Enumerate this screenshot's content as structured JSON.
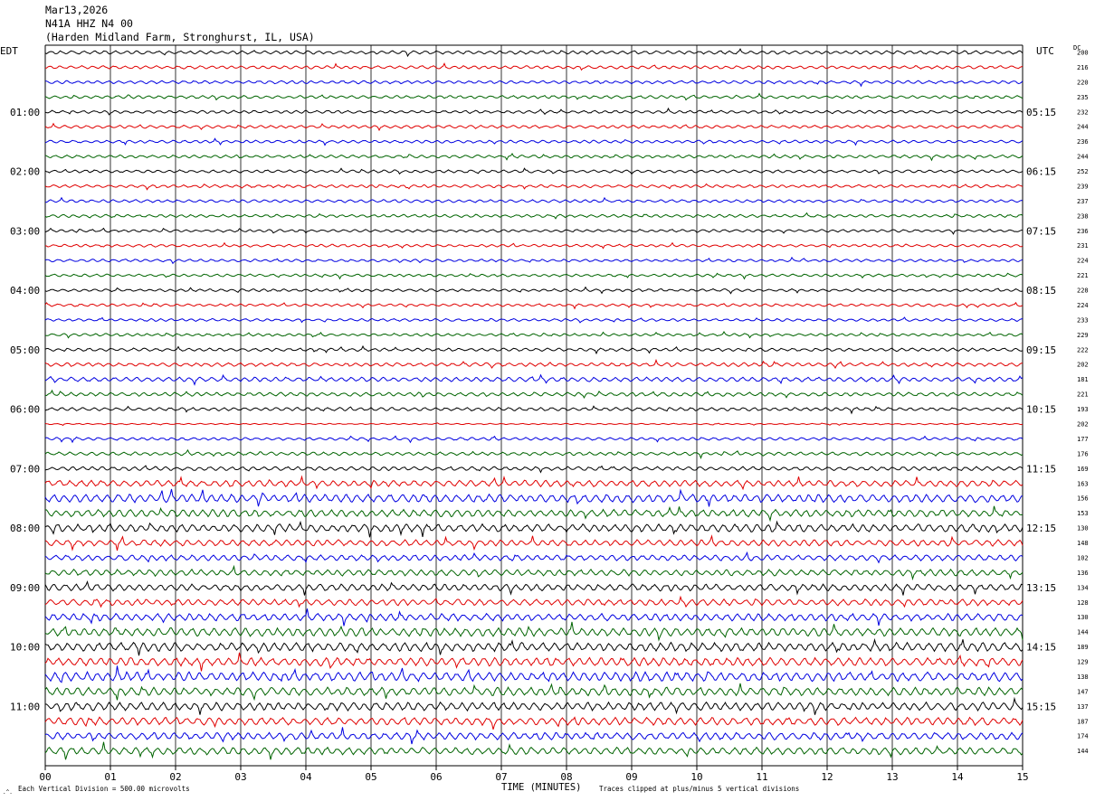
{
  "header": {
    "date": "Mar13,2026",
    "channel": "N41A HHZ N4 00",
    "location": "(Harden Midland Farm, Stronghurst, IL, USA)"
  },
  "labels": {
    "left_tz": "EDT",
    "right_tz": "UTC",
    "dc": "DC",
    "xlabel": "TIME (MINUTES)",
    "footer_left": "Each Vertical Division =  500.00 microvolts",
    "footer_right": "Traces clipped at plus/minus 5 vertical divisions"
  },
  "colors": {
    "black": "#000000",
    "red": "#e00000",
    "blue": "#0000e0",
    "green": "#006400",
    "grid": "#000000"
  },
  "chart_data": {
    "type": "seismogram",
    "trace_minutes": 15,
    "x_ticks": [
      "00",
      "01",
      "02",
      "03",
      "04",
      "05",
      "06",
      "07",
      "08",
      "09",
      "10",
      "11",
      "12",
      "13",
      "14",
      "15"
    ],
    "left_hour_labels": [
      "01:00",
      "02:00",
      "03:00",
      "04:00",
      "05:00",
      "06:00",
      "07:00",
      "08:00",
      "09:00",
      "10:00",
      "11:00"
    ],
    "right_hour_labels": [
      "05:15",
      "06:15",
      "07:15",
      "08:15",
      "09:15",
      "10:15",
      "11:15",
      "12:15",
      "13:15",
      "14:15",
      "15:15"
    ],
    "trace_colors": [
      "black",
      "red",
      "blue",
      "green"
    ],
    "dc_offsets": [
      200,
      216,
      220,
      235,
      232,
      244,
      236,
      244,
      252,
      239,
      237,
      238,
      236,
      231,
      224,
      221,
      228,
      224,
      233,
      229,
      222,
      202,
      181,
      221,
      193,
      202,
      177,
      176,
      169,
      163,
      156,
      153,
      130,
      148,
      102,
      136,
      134,
      128,
      130,
      144,
      189,
      129,
      138,
      147,
      137,
      187,
      174,
      144
    ],
    "amplitude": [
      1.4,
      1.3,
      1.3,
      1.2,
      1.2,
      1.2,
      1.2,
      1.2,
      1.2,
      1.2,
      1.2,
      1.2,
      1.1,
      1.1,
      1.1,
      1.1,
      1.1,
      1.1,
      1.1,
      1.1,
      1.3,
      1.5,
      1.8,
      1.6,
      1.4,
      0.5,
      1.2,
      1.4,
      1.6,
      2.6,
      3.4,
      3.0,
      3.2,
      2.6,
      2.4,
      2.6,
      2.8,
      2.6,
      3.0,
      3.4,
      3.6,
      3.4,
      3.8,
      3.4,
      3.4,
      3.2,
      3.0,
      3.0
    ]
  }
}
